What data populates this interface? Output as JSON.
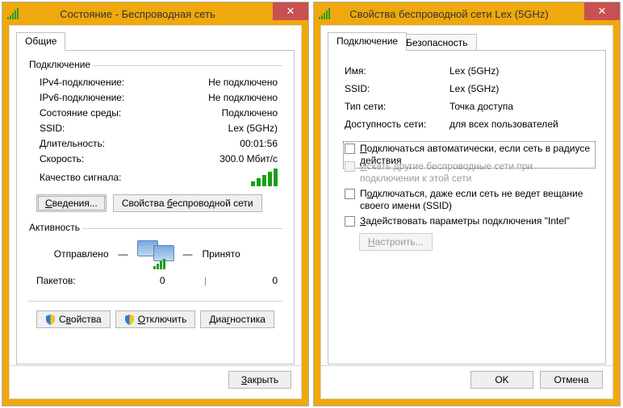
{
  "status_window": {
    "title": "Состояние - Беспроводная сеть",
    "tab_general": "Общие",
    "group_connection": "Подключение",
    "rows": {
      "ipv4_label": "IРv4-подключение:",
      "ipv4_value": "Не подключено",
      "ipv6_label": "IРv6-подключение:",
      "ipv6_value": "Не подключено",
      "media_label": "Состояние среды:",
      "media_value": "Подключено",
      "ssid_label": "SSID:",
      "ssid_value": "Lex (5GHz)",
      "duration_label": "Длительность:",
      "duration_value": "00:01:56",
      "speed_label": "Скорость:",
      "speed_value": "300.0 Мбит/с",
      "quality_label": "Качество сигнала:"
    },
    "buttons": {
      "details": "Сведения...",
      "wireless_props": "Свойства беспроводной сети"
    },
    "group_activity": "Активность",
    "activity": {
      "sent": "Отправлено",
      "received": "Принято",
      "packets_label": "Пакетов:",
      "packets_sent": "0",
      "packets_received": "0"
    },
    "bottom": {
      "properties": "Свойства",
      "disable": "Отключить",
      "diagnose": "Диагностика",
      "close": "Закрыть"
    }
  },
  "props_window": {
    "title": "Свойства беспроводной сети Lex (5GHz)",
    "tab_conn": "Подключение",
    "tab_sec": "Безопасность",
    "fields": {
      "name_label": "Имя:",
      "name_value": "Lex (5GHz)",
      "ssid_label": "SSID:",
      "ssid_value": "Lex (5GHz)",
      "nettype_label": "Тип сети:",
      "nettype_value": "Точка доступа",
      "avail_label": "Доступность сети:",
      "avail_value": "для всех пользователей"
    },
    "chk_auto": "Подключаться автоматически, если сеть в радиусе действия",
    "chk_other": "Искать другие беспроводные сети при подключении к этой сети",
    "chk_hidden": "Подключаться, даже если сеть не ведет вещание своего имени (SSID)",
    "chk_intel": "Задействовать параметры подключения \"Intel\"",
    "configure": "Настроить...",
    "ok": "OK",
    "cancel": "Отмена"
  }
}
